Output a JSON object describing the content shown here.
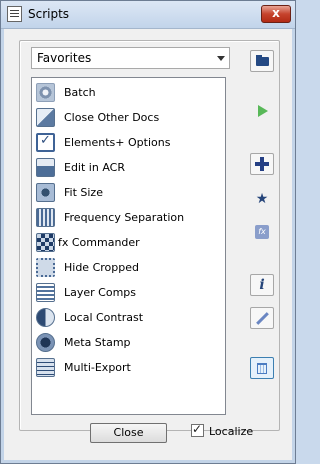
{
  "window": {
    "title": "Scripts",
    "close_glyph": "x"
  },
  "dropdown": {
    "selected": "Favorites"
  },
  "list": {
    "items": [
      {
        "label": "Batch",
        "icon": "gear-icon"
      },
      {
        "label": "Close Other Docs",
        "icon": "close-other-docs-icon"
      },
      {
        "label": "Elements+ Options",
        "icon": "checkbox-options-icon"
      },
      {
        "label": "Edit in ACR",
        "icon": "acr-icon"
      },
      {
        "label": "Fit Size",
        "icon": "fit-size-icon"
      },
      {
        "label": "Frequency Separation",
        "icon": "frequency-separation-icon"
      },
      {
        "label": "fx Commander",
        "icon": "fx-commander-icon"
      },
      {
        "label": "Hide Cropped",
        "icon": "hide-cropped-icon"
      },
      {
        "label": "Layer Comps",
        "icon": "layer-comps-icon"
      },
      {
        "label": "Local Contrast",
        "icon": "local-contrast-icon"
      },
      {
        "label": "Meta Stamp",
        "icon": "meta-stamp-icon"
      },
      {
        "label": "Multi-Export",
        "icon": "multi-export-icon"
      }
    ]
  },
  "sidebar": {
    "buttons": [
      {
        "name": "open-folder-button",
        "icon": "folder-icon"
      },
      {
        "name": "run-button",
        "icon": "play-icon"
      },
      {
        "name": "add-button",
        "icon": "plus-icon"
      },
      {
        "name": "favorite-button",
        "icon": "star-icon"
      },
      {
        "name": "fx-button",
        "icon": "fx-icon",
        "text": "fx"
      },
      {
        "name": "info-button",
        "icon": "info-icon",
        "text": "i"
      },
      {
        "name": "edit-button",
        "icon": "pencil-icon"
      },
      {
        "name": "delete-button",
        "icon": "trash-icon"
      }
    ]
  },
  "footer": {
    "close_label": "Close",
    "localize_label": "Localize",
    "localize_checked": true
  },
  "colors": {
    "accent": "#26457a",
    "play": "#58b858",
    "titlebar_close": "#c6432d"
  }
}
